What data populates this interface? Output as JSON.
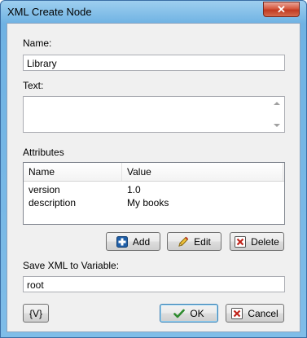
{
  "window": {
    "title": "XML Create Node",
    "close_label": "✕"
  },
  "name_field": {
    "label": "Name:",
    "value": "Library"
  },
  "text_field": {
    "label": "Text:",
    "value": ""
  },
  "attributes": {
    "label": "Attributes",
    "columns": [
      "Name",
      "Value"
    ],
    "rows": [
      {
        "name": "version",
        "value": "1.0"
      },
      {
        "name": "description",
        "value": "My books"
      }
    ],
    "buttons": {
      "add": "Add",
      "edit": "Edit",
      "delete": "Delete"
    }
  },
  "save_var": {
    "label": "Save XML to Variable:",
    "value": "root"
  },
  "footer": {
    "variable_button": "{V}",
    "ok": "OK",
    "cancel": "Cancel"
  }
}
